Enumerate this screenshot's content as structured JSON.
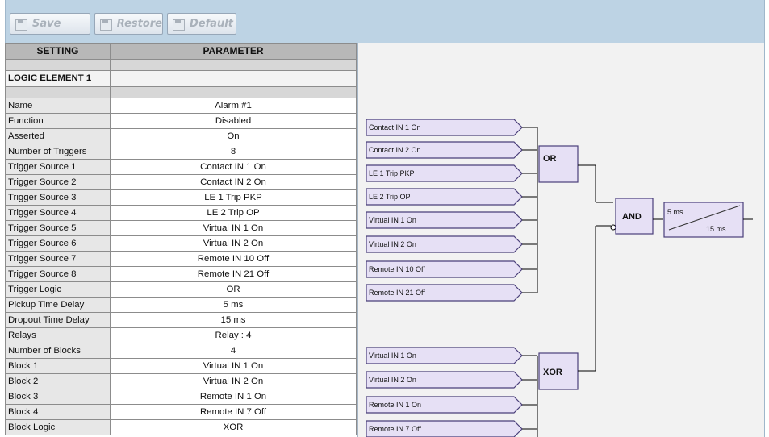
{
  "toolbar": {
    "save_label": "Save",
    "restore_label": "Restore",
    "default_label": "Default"
  },
  "table": {
    "col_setting": "SETTING",
    "col_parameter": "PARAMETER",
    "section_title": "LOGIC ELEMENT 1",
    "rows": [
      {
        "setting": "Name",
        "value": "Alarm #1"
      },
      {
        "setting": "Function",
        "value": "Disabled"
      },
      {
        "setting": "Asserted",
        "value": "On"
      },
      {
        "setting": "Number of Triggers",
        "value": "8"
      },
      {
        "setting": "Trigger Source 1",
        "value": "Contact IN 1 On"
      },
      {
        "setting": "Trigger Source 2",
        "value": "Contact IN 2 On"
      },
      {
        "setting": "Trigger Source 3",
        "value": "LE 1 Trip PKP"
      },
      {
        "setting": "Trigger Source 4",
        "value": "LE 2 Trip OP"
      },
      {
        "setting": "Trigger Source 5",
        "value": "Virtual IN 1 On"
      },
      {
        "setting": "Trigger Source 6",
        "value": "Virtual IN 2 On"
      },
      {
        "setting": "Trigger Source 7",
        "value": "Remote IN 10 Off"
      },
      {
        "setting": "Trigger Source 8",
        "value": "Remote IN 21 Off"
      },
      {
        "setting": "Trigger Logic",
        "value": "OR"
      },
      {
        "setting": "Pickup Time Delay",
        "value": "5 ms"
      },
      {
        "setting": "Dropout Time Delay",
        "value": "15 ms"
      },
      {
        "setting": "Relays",
        "value": "Relay : 4"
      },
      {
        "setting": "Number of Blocks",
        "value": "4"
      },
      {
        "setting": "Block 1",
        "value": "Virtual IN 1 On"
      },
      {
        "setting": "Block 2",
        "value": "Virtual IN 2 On"
      },
      {
        "setting": "Block 3",
        "value": "Remote IN 1 On"
      },
      {
        "setting": "Block 4",
        "value": "Remote IN 7 Off"
      },
      {
        "setting": "Block Logic",
        "value": "XOR"
      }
    ]
  },
  "diagram": {
    "trigger_inputs": [
      "Contact IN 1 On",
      "Contact IN 2 On",
      "LE 1 Trip PKP",
      "LE 2 Trip OP",
      "Virtual IN 1 On",
      "Virtual IN 2 On",
      "Remote IN 10 Off",
      "Remote IN 21 Off"
    ],
    "block_inputs": [
      "Virtual IN 1 On",
      "Virtual IN 2 On",
      "Remote IN 1 On",
      "Remote IN 7 Off"
    ],
    "trigger_gate": "OR",
    "block_gate": "XOR",
    "and_gate": "AND",
    "timer_pickup": "5 ms",
    "timer_dropout": "15 ms"
  },
  "colors": {
    "toolbar_bg": "#bdd3e4",
    "input_box_fill": "#e6e0f5",
    "input_box_stroke": "#4a3f7a",
    "diagram_bg": "#f2f2f2"
  }
}
